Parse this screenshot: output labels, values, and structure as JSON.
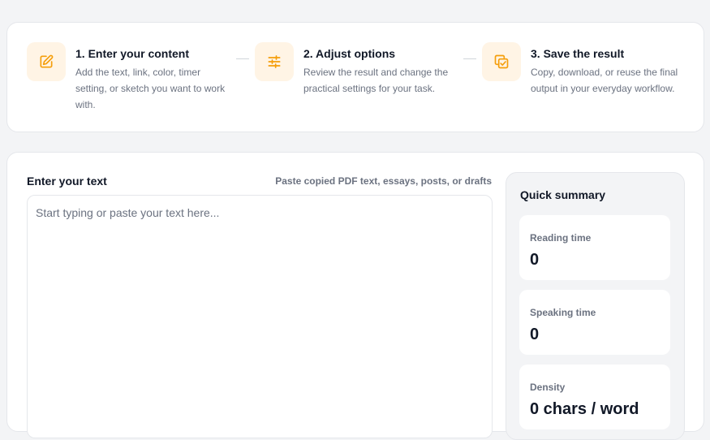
{
  "steps": [
    {
      "icon": "pencil-square-icon",
      "title": "1. Enter your content",
      "description": "Add the text, link, color, timer setting, or sketch you want to work with."
    },
    {
      "icon": "sliders-icon",
      "title": "2. Adjust options",
      "description": "Review the result and change the practical settings for your task."
    },
    {
      "icon": "copy-check-icon",
      "title": "3. Save the result",
      "description": "Copy, download, or reuse the final output in your everyday workflow."
    }
  ],
  "input": {
    "label": "Enter your text",
    "hint": "Paste copied PDF text, essays, posts, or drafts",
    "placeholder": "Start typing or paste your text here...",
    "value": ""
  },
  "summary": {
    "title": "Quick summary",
    "stats": [
      {
        "label": "Reading time",
        "value": "0"
      },
      {
        "label": "Speaking time",
        "value": "0"
      },
      {
        "label": "Density",
        "value": "0 chars / word"
      }
    ]
  },
  "colors": {
    "accent": "#f59e0b",
    "icon_bg": "#fff4e5",
    "card_bg": "#ffffff",
    "page_bg": "#f3f4f6",
    "border": "#e5e7eb",
    "text_primary": "#111827",
    "text_secondary": "#6b7280"
  }
}
